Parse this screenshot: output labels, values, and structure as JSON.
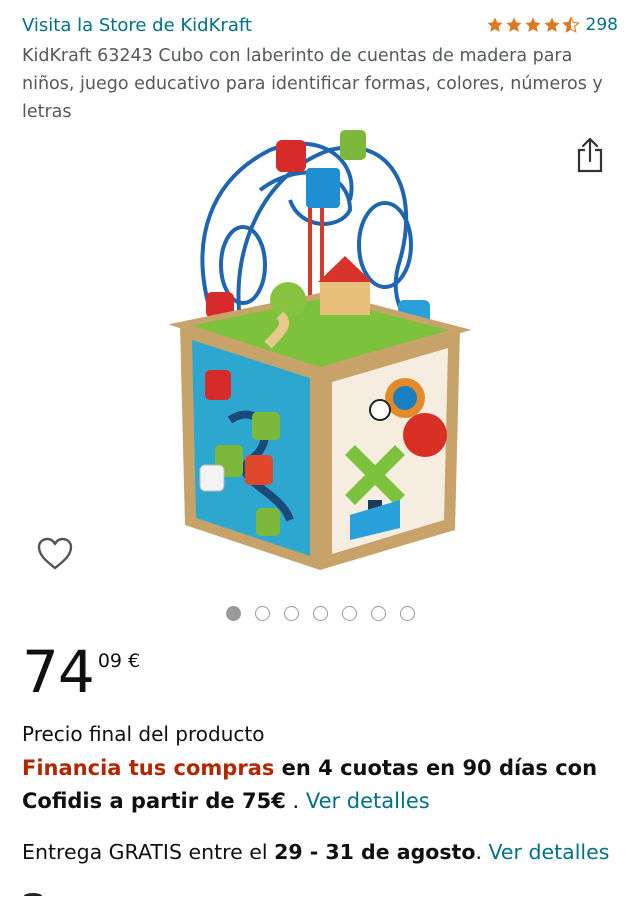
{
  "header": {
    "store_link": "Visita la Store de KidKraft",
    "rating_stars": 4.5,
    "rating_count": "298",
    "star_color": "#de7921"
  },
  "product": {
    "title": "KidKraft 63243 Cubo con laberinto de cuentas de madera para niños, juego educativo para identificar formas, colores, números y letras",
    "share_icon": "share-icon",
    "wishlist_icon": "heart-icon"
  },
  "gallery": {
    "image_count": 7,
    "active_index": 0
  },
  "price": {
    "whole": "74",
    "fraction": "09 €"
  },
  "final_price_label": "Precio final del producto",
  "finance": {
    "highlight": "Financia tus compras",
    "text": " en 4 cuotas en 90 días con Cofidis a partir de 75€",
    "separator": " . ",
    "link": "Ver detalles"
  },
  "delivery": {
    "prefix": "Entrega GRATIS entre el ",
    "dates": "29 - 31 de agosto",
    "suffix": ". ",
    "link": "Ver detalles"
  }
}
